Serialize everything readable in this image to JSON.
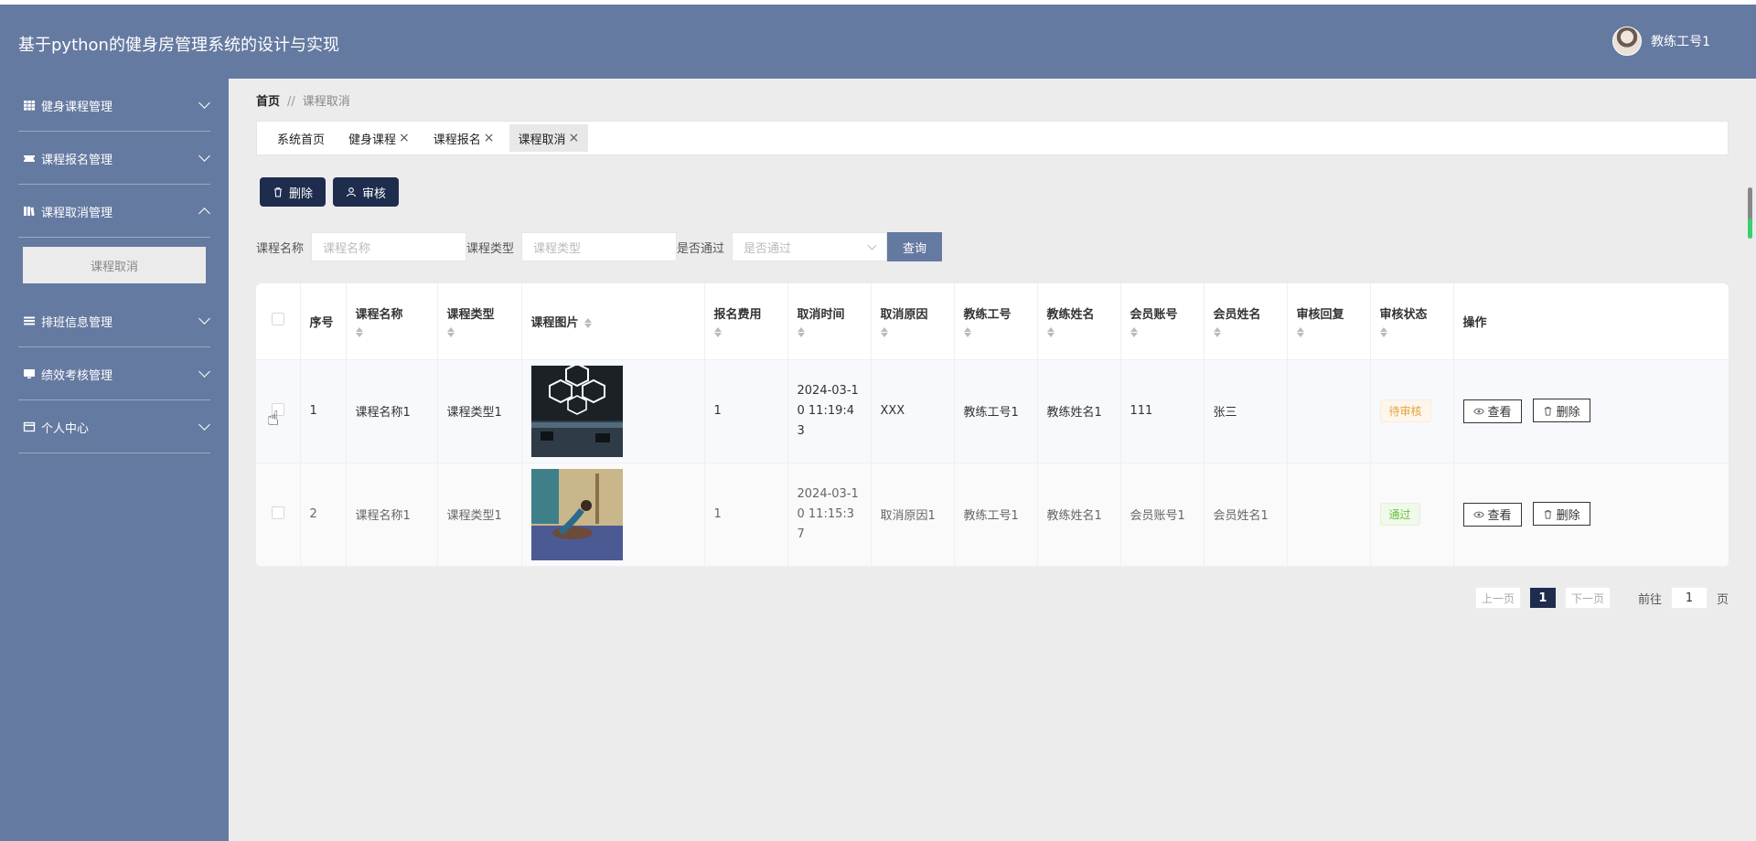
{
  "app": {
    "title": "基于python的健身房管理系统的设计与实现",
    "user_name": "教练工号1"
  },
  "sidebar": {
    "items": [
      {
        "label": "健身课程管理",
        "icon": "grid-icon",
        "expanded": false
      },
      {
        "label": "课程报名管理",
        "icon": "ticket-icon",
        "expanded": false
      },
      {
        "label": "课程取消管理",
        "icon": "book-icon",
        "expanded": true
      },
      {
        "label": "排班信息管理",
        "icon": "list-icon",
        "expanded": false
      },
      {
        "label": "绩效考核管理",
        "icon": "monitor-icon",
        "expanded": false
      },
      {
        "label": "个人中心",
        "icon": "card-icon",
        "expanded": false
      }
    ],
    "submenu": {
      "label": "课程取消"
    }
  },
  "breadcrumb": {
    "home": "首页",
    "sep": "//",
    "current": "课程取消"
  },
  "tabs": [
    {
      "label": "系统首页",
      "closable": false
    },
    {
      "label": "健身课程",
      "closable": true
    },
    {
      "label": "课程报名",
      "closable": true
    },
    {
      "label": "课程取消",
      "closable": true,
      "active": true
    }
  ],
  "toolbar": {
    "delete_label": "删除",
    "review_label": "审核"
  },
  "filters": {
    "course_name_label": "课程名称",
    "course_name_placeholder": "课程名称",
    "course_type_label": "课程类型",
    "course_type_placeholder": "课程类型",
    "passed_label": "是否通过",
    "passed_placeholder": "是否通过",
    "query_label": "查询"
  },
  "table": {
    "headers": [
      "序号",
      "课程名称",
      "课程类型",
      "课程图片",
      "报名费用",
      "取消时间",
      "取消原因",
      "教练工号",
      "教练姓名",
      "会员账号",
      "会员姓名",
      "审核回复",
      "审核状态",
      "操作"
    ],
    "rows": [
      {
        "index": "1",
        "course_name": "课程名称1",
        "course_type": "课程类型1",
        "fee": "1",
        "cancel_time": "2024-03-10 11:19:43",
        "reason": "XXX",
        "coach_id": "教练工号1",
        "coach_name": "教练姓名1",
        "member_account": "111",
        "member_name": "张三",
        "reply": "",
        "status": "待审核"
      },
      {
        "index": "2",
        "course_name": "课程名称1",
        "course_type": "课程类型1",
        "fee": "1",
        "cancel_time": "2024-03-10 11:15:37",
        "reason": "取消原因1",
        "coach_id": "教练工号1",
        "coach_name": "教练姓名1",
        "member_account": "会员账号1",
        "member_name": "会员姓名1",
        "reply": "",
        "status": "通过"
      }
    ],
    "view_label": "查看",
    "delete_label": "删除"
  },
  "pager": {
    "prev": "上一页",
    "current": "1",
    "next": "下一页",
    "goto": "前往",
    "goto_value": "1",
    "page_unit": "页"
  },
  "colors": {
    "header_bg": "#657aa1",
    "dark_button": "#1e2d4e",
    "pending": "#e6a23c",
    "passed": "#67c23a"
  }
}
